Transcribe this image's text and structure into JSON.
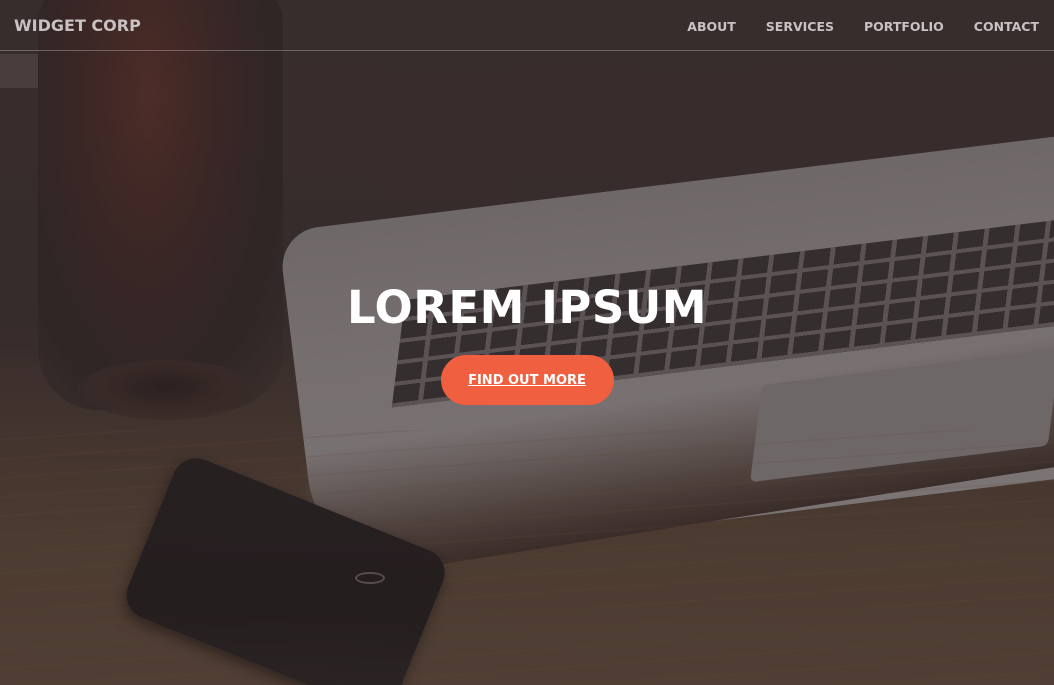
{
  "brand": {
    "name": "WIDGET CORP"
  },
  "nav": {
    "items": [
      {
        "label": "ABOUT"
      },
      {
        "label": "SERVICES"
      },
      {
        "label": "PORTFOLIO"
      },
      {
        "label": "CONTACT"
      }
    ]
  },
  "hero": {
    "heading": "LOREM IPSUM",
    "cta_label": "FIND OUT MORE",
    "background_image": "desk with laptop, smartphone and glass",
    "colors": {
      "cta": "#f05f40",
      "heading": "#ffffff",
      "nav_text": "#c9c2c2"
    }
  }
}
